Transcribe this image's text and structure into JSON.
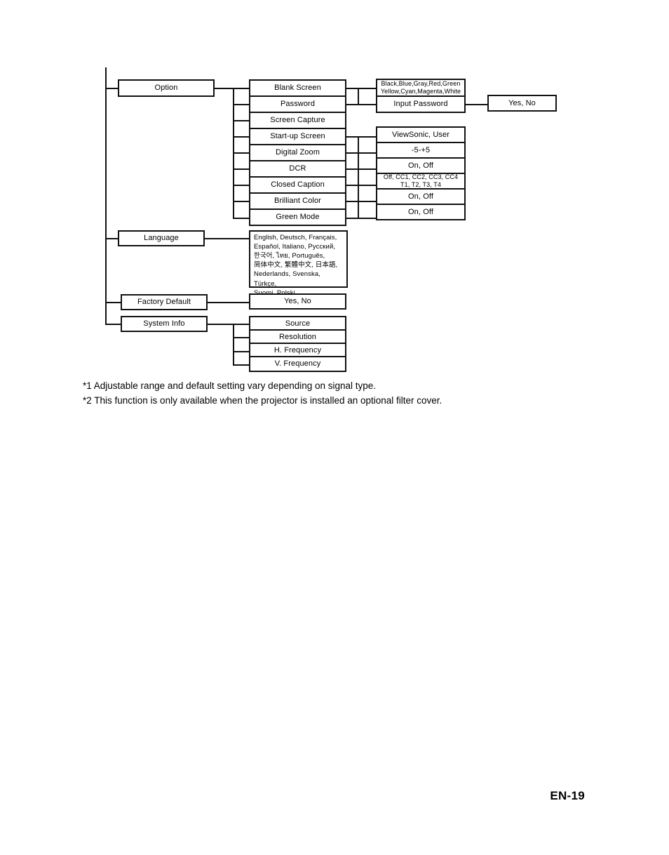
{
  "document": {
    "page_label": "EN-19",
    "footnotes": [
      "*1 Adjustable range and default setting vary depending on signal type.",
      "*2 This function is only available when the projector is installed an optional filter cover."
    ]
  },
  "diagram": {
    "type": "menu-tree",
    "root_branches": [
      {
        "label": "Option"
      },
      {
        "label": "Language"
      },
      {
        "label": "Factory Default"
      },
      {
        "label": "System Info"
      }
    ],
    "option_menu": {
      "label": "Option",
      "items": [
        {
          "label": "Blank Screen",
          "value": "Black,Blue,Gray,Red,Green\nYellow,Cyan,Magenta,White"
        },
        {
          "label": "Password",
          "value": "Input Password"
        },
        {
          "label": "Screen Capture",
          "value": ""
        },
        {
          "label": "Start-up Screen",
          "value": "ViewSonic, User"
        },
        {
          "label": "Digital Zoom",
          "value": "-5-+5"
        },
        {
          "label": "DCR",
          "value": "On, Off"
        },
        {
          "label": "Closed Caption",
          "value": "Off, CC1, CC2, CC3, CC4\nT1, T2, T3, T4"
        },
        {
          "label": "Brilliant Color",
          "value": "On, Off"
        },
        {
          "label": "Green Mode",
          "value": "On, Off"
        }
      ],
      "password_confirm": "Yes, No"
    },
    "language_menu": {
      "label": "Language",
      "languages": "English, Deutsch, Français,\nEspañol, Italiano, Русский,\n한국어, ไทย, Português,\n简体中文, 繁體中文, 日本語,\nNederlands, Svenska, Türkçe,\nSuomi, Polski"
    },
    "factory_default": {
      "label": "Factory Default",
      "value": "Yes, No"
    },
    "system_info": {
      "label": "System Info",
      "items": [
        {
          "label": "Source"
        },
        {
          "label": "Resolution"
        },
        {
          "label": "H. Frequency"
        },
        {
          "label": "V. Frequency"
        }
      ]
    }
  }
}
